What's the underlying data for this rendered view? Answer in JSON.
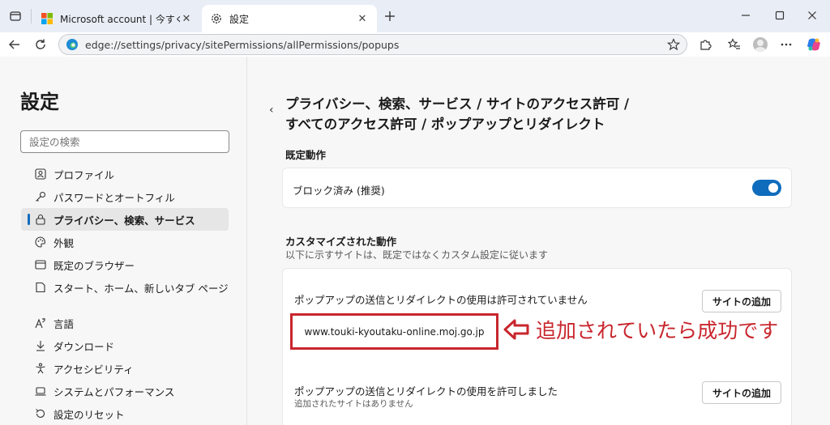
{
  "browser": {
    "tabs": [
      {
        "title": "Microsoft account | 今すぐサインイン",
        "active": false,
        "favicon": "microsoft-logo"
      },
      {
        "title": "設定",
        "active": true,
        "favicon": "gear-icon"
      }
    ],
    "address_url": "edge://settings/privacy/sitePermissions/allPermissions/popups"
  },
  "sidebar": {
    "title": "設定",
    "search_placeholder": "設定の検索",
    "items": [
      {
        "label": "プロファイル",
        "icon": "profile-icon"
      },
      {
        "label": "パスワードとオートフィル",
        "icon": "key-icon"
      },
      {
        "label": "プライバシー、検索、サービス",
        "icon": "lock-icon",
        "selected": true
      },
      {
        "label": "外観",
        "icon": "palette-icon"
      },
      {
        "label": "既定のブラウザー",
        "icon": "browser-window-icon"
      },
      {
        "label": "スタート、ホーム、新しいタブ ページ",
        "icon": "home-page-icon"
      },
      {
        "label": "言語",
        "icon": "language-icon"
      },
      {
        "label": "ダウンロード",
        "icon": "download-icon"
      },
      {
        "label": "アクセシビリティ",
        "icon": "accessibility-icon"
      },
      {
        "label": "システムとパフォーマンス",
        "icon": "laptop-icon"
      },
      {
        "label": "設定のリセット",
        "icon": "reset-icon"
      }
    ]
  },
  "content": {
    "breadcrumb_line1": "プライバシー、検索、サービス / サイトのアクセス許可 /",
    "breadcrumb_line2": "すべてのアクセス許可 / ポップアップとリダイレクト",
    "default_section_title": "既定動作",
    "default_card_label": "ブロック済み (推奨)",
    "default_toggle_on": true,
    "custom_section_title": "カスタマイズされた動作",
    "custom_section_subtitle": "以下に示すサイトは、既定ではなくカスタム設定に従います",
    "block_card_label": "ポップアップの送信とリダイレクトの使用は許可されていません",
    "add_site_label": "サイトの追加",
    "blocked_site": "www.touki-kyoutaku-online.moj.go.jp",
    "allow_card_label": "ポップアップの送信とリダイレクトの使用を許可しました",
    "allow_card_empty": "追加されたサイトはありません"
  },
  "annotation": {
    "message": "追加されていたら成功です",
    "color": "#c8262d"
  },
  "colors": {
    "accent": "#0f6cbd",
    "annotation_red": "#c8262d"
  }
}
